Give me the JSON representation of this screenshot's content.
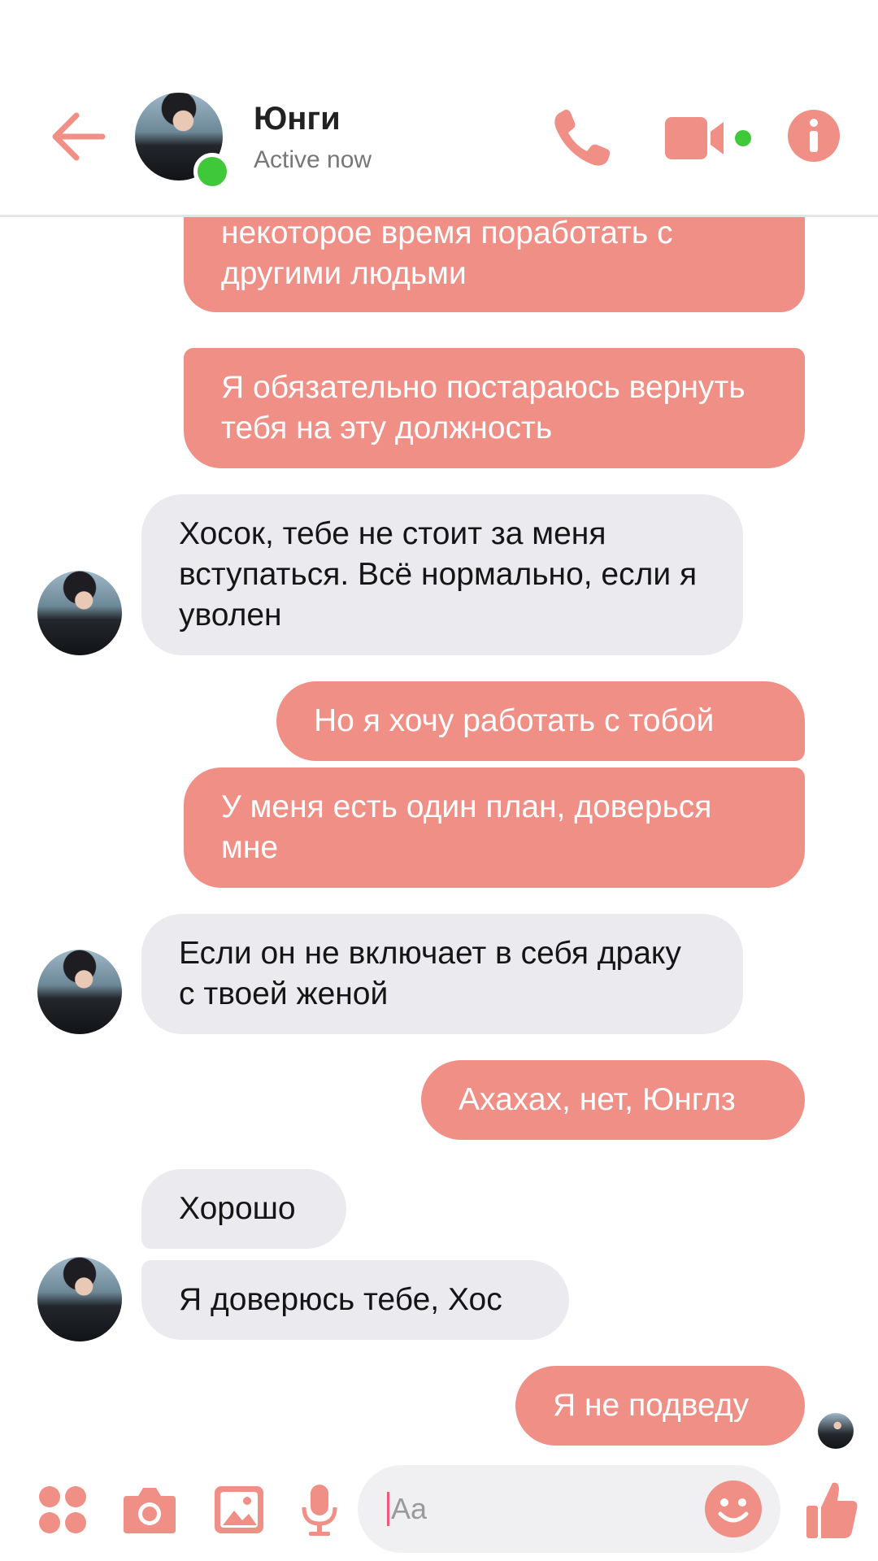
{
  "header": {
    "contact_name": "Юнги",
    "status": "Active now"
  },
  "colors": {
    "accent": "#ef8f86",
    "incoming_bubble": "#ebeaee",
    "online": "#3fc93a"
  },
  "messages": [
    {
      "dir": "out",
      "text": "помощником мне. Может придётся некоторое время поработать с другими людьми"
    },
    {
      "dir": "out",
      "text": "Я обязательно постараюсь вернуть тебя на эту должность"
    },
    {
      "dir": "in",
      "text": "Хосок, тебе не стоит за меня вступаться. Всё нормально, если я уволен"
    },
    {
      "dir": "out",
      "text": "Но я хочу работать с тобой"
    },
    {
      "dir": "out",
      "text": "У меня есть один план, доверься мне"
    },
    {
      "dir": "in",
      "text": "Если он не включает в себя драку с твоей женой"
    },
    {
      "dir": "out",
      "text": "Ахахах, нет, Юнглз"
    },
    {
      "dir": "in",
      "text": "Хорошо"
    },
    {
      "dir": "in",
      "text": "Я доверюсь тебе, Хос"
    },
    {
      "dir": "out",
      "text": "Я не подведу"
    }
  ],
  "composer": {
    "placeholder": "Aa",
    "icons": [
      "apps-icon",
      "camera-icon",
      "gallery-icon",
      "microphone-icon",
      "emoji-icon",
      "thumbs-up-icon"
    ]
  }
}
